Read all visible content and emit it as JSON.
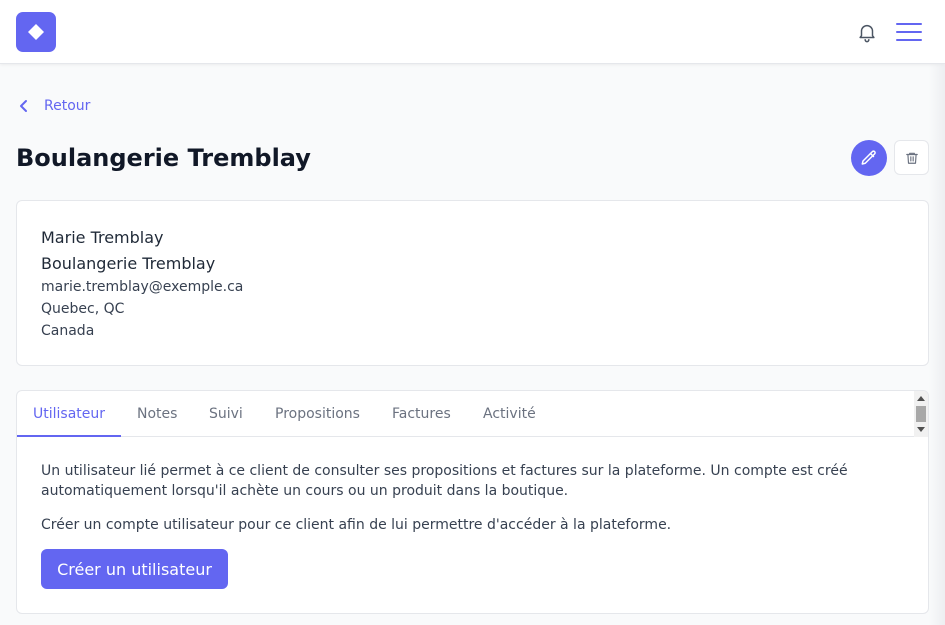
{
  "header": {
    "logo_icon": "diamond-icon",
    "notification_icon": "bell-icon",
    "menu_icon": "hamburger-menu-icon"
  },
  "nav": {
    "back_label": "Retour"
  },
  "page": {
    "title": "Boulangerie Tremblay"
  },
  "client": {
    "contact_name": "Marie Tremblay",
    "company": "Boulangerie Tremblay",
    "email": "marie.tremblay@exemple.ca",
    "city_region": "Quebec, QC",
    "country": "Canada"
  },
  "tabs": [
    {
      "label": "Utilisateur",
      "active": true
    },
    {
      "label": "Notes",
      "active": false
    },
    {
      "label": "Suivi",
      "active": false
    },
    {
      "label": "Propositions",
      "active": false
    },
    {
      "label": "Factures",
      "active": false
    },
    {
      "label": "Activité",
      "active": false
    }
  ],
  "user_tab": {
    "description": "Un utilisateur lié permet à ce client de consulter ses propositions et factures sur la plateforme. Un compte est créé automatiquement lorsqu'il achète un cours ou un produit dans la boutique.",
    "prompt": "Créer un compte utilisateur pour ce client afin de lui permettre d'accéder à la plateforme.",
    "create_button": "Créer un utilisateur"
  },
  "colors": {
    "accent": "#6366f1",
    "text_dark": "#111827",
    "text_muted": "#6b7280",
    "border": "#e5e7eb",
    "background": "#f9fafb"
  }
}
